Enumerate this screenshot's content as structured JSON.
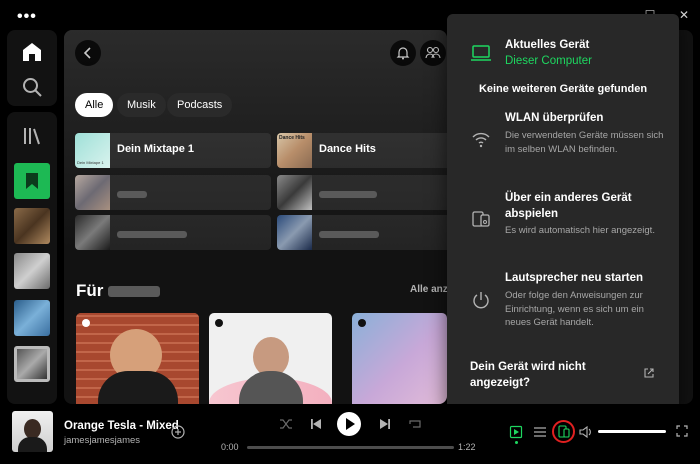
{
  "window": {
    "menu_icon": "more-horizontal-icon",
    "minimize": "–",
    "maximize": "☐",
    "close": "✕"
  },
  "sidebar": {
    "icons": [
      "home-icon",
      "search-icon",
      "library-icon"
    ]
  },
  "main": {
    "chips": [
      {
        "label": "Alle",
        "active": true
      },
      {
        "label": "Musik",
        "active": false
      },
      {
        "label": "Podcasts",
        "active": false
      }
    ],
    "shortcuts": [
      {
        "label": "Dein Mixtape 1",
        "art_text": "Dein Mixtape 1"
      },
      {
        "label": "Dance Hits",
        "art_text": "Dance Hits"
      }
    ],
    "section_title": "Für",
    "show_all": "Alle anz"
  },
  "device_popup": {
    "title": "Aktuelles Gerät",
    "subtitle": "Dieser Computer",
    "no_devices": "Keine weiteren Geräte gefunden",
    "tips": [
      {
        "icon": "wifi-icon",
        "title": "WLAN überprüfen",
        "body": "Die verwendeten Geräte müssen sich im selben WLAN befinden."
      },
      {
        "icon": "device-connect-icon",
        "title": "Über ein anderes Gerät abspielen",
        "body": "Es wird automatisch hier angezeigt."
      },
      {
        "icon": "power-icon",
        "title": "Lautsprecher neu starten",
        "body": "Oder folge den Anweisungen zur Einrichtung, wenn es sich um ein neues Gerät handelt."
      }
    ],
    "footer": "Dein Gerät wird nicht angezeigt?",
    "accent": "#1ed760"
  },
  "player": {
    "track_title": "Orange Tesla - Mixed",
    "artist": "jamesjamesjames",
    "time_current": "0:00",
    "time_total": "1:22",
    "progress": 0,
    "volume": 1
  }
}
